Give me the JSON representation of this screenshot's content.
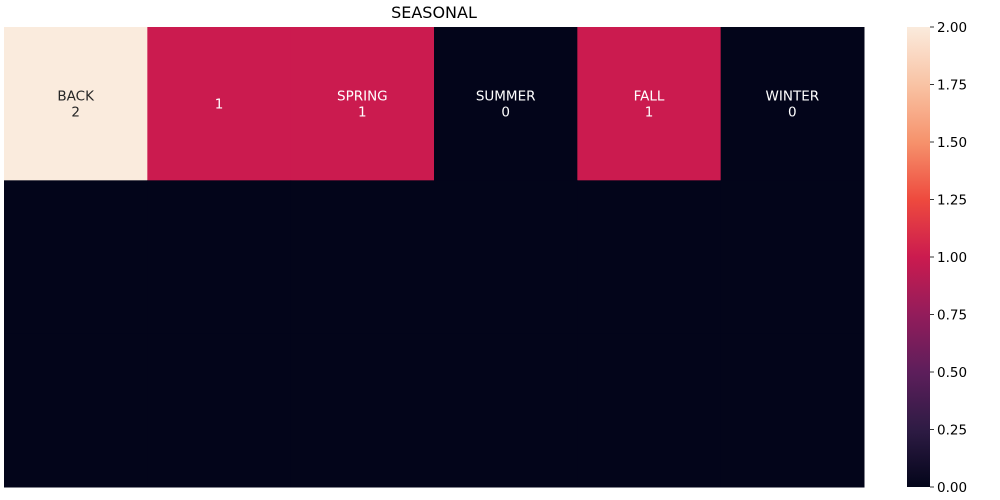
{
  "chart_data": {
    "type": "heatmap",
    "title": "SEASONAL",
    "rows": 3,
    "cols": 6,
    "cells": [
      {
        "row": 0,
        "col": 0,
        "value": 2,
        "label_lines": [
          "BACK",
          "2"
        ]
      },
      {
        "row": 0,
        "col": 1,
        "value": 1,
        "label_lines": [
          "1"
        ]
      },
      {
        "row": 0,
        "col": 2,
        "value": 1,
        "label_lines": [
          "SPRING",
          "1"
        ]
      },
      {
        "row": 0,
        "col": 3,
        "value": 0,
        "label_lines": [
          "SUMMER",
          "0"
        ]
      },
      {
        "row": 0,
        "col": 4,
        "value": 1,
        "label_lines": [
          "FALL",
          "1"
        ]
      },
      {
        "row": 0,
        "col": 5,
        "value": 0,
        "label_lines": [
          "WINTER",
          "0"
        ]
      },
      {
        "row": 1,
        "col": 0,
        "value": 0
      },
      {
        "row": 1,
        "col": 1,
        "value": 0
      },
      {
        "row": 1,
        "col": 2,
        "value": 0
      },
      {
        "row": 1,
        "col": 3,
        "value": 0
      },
      {
        "row": 1,
        "col": 4,
        "value": 0
      },
      {
        "row": 1,
        "col": 5,
        "value": 0
      },
      {
        "row": 2,
        "col": 0,
        "value": 0
      },
      {
        "row": 2,
        "col": 1,
        "value": 0
      },
      {
        "row": 2,
        "col": 2,
        "value": 0
      },
      {
        "row": 2,
        "col": 3,
        "value": 0
      },
      {
        "row": 2,
        "col": 4,
        "value": 0
      },
      {
        "row": 2,
        "col": 5,
        "value": 0
      }
    ],
    "colorbar": {
      "min": 0,
      "max": 2,
      "ticks": [
        "0.00",
        "0.25",
        "0.50",
        "0.75",
        "1.00",
        "1.25",
        "1.50",
        "1.75",
        "2.00"
      ],
      "colormap": "rocket",
      "stops": [
        "#03051a",
        "#2e1b44",
        "#5d1e5b",
        "#931c5b",
        "#cb1b4f",
        "#ee4a3e",
        "#f6926c",
        "#f9c3a4",
        "#faebdd"
      ]
    },
    "grid": false,
    "legend": "colorbar-right"
  }
}
